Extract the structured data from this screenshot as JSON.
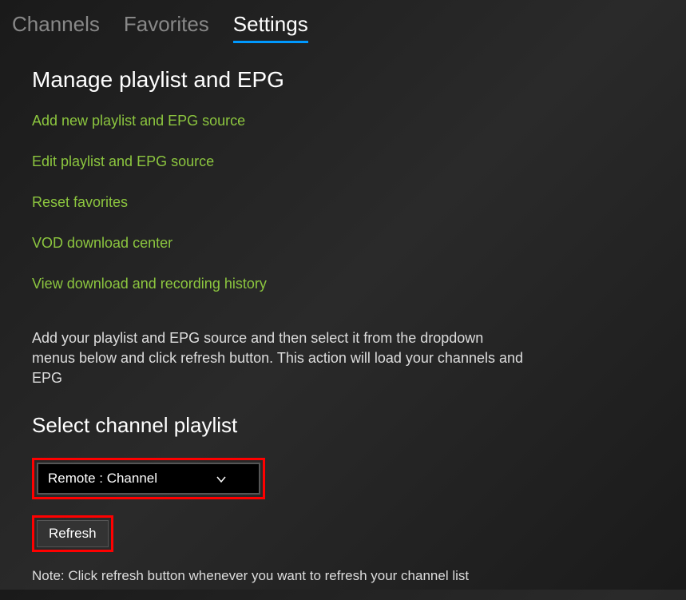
{
  "tabs": {
    "channels": "Channels",
    "favorites": "Favorites",
    "settings": "Settings"
  },
  "section_title": "Manage playlist and EPG",
  "links": {
    "add_new": "Add new playlist and EPG source",
    "edit": "Edit playlist and EPG source",
    "reset_fav": "Reset favorites",
    "vod_center": "VOD download center",
    "view_history": "View download and recording history"
  },
  "description": "Add your playlist and EPG source and then select it from the dropdown menus below and click refresh button. This action will load your channels and EPG",
  "select_title": "Select channel playlist",
  "dropdown_value": "Remote : Channel",
  "refresh_label": "Refresh",
  "note": "Note: Click refresh button whenever you want to refresh your channel list"
}
